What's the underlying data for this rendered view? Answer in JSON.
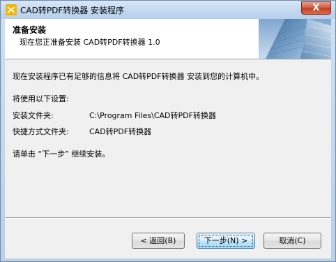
{
  "window": {
    "title": "CAD转PDF转换器 安装程序",
    "close_label": "X"
  },
  "header": {
    "title": "准备安装",
    "subtitle": "现在您正准备安装 CAD转PDF转换器 1.0"
  },
  "content": {
    "intro": "现在安装程序已有足够的信息将 CAD转PDF转换器 安装到您的计算机中。",
    "settings_heading": "将使用以下设置:",
    "install_folder_label": "安装文件夹:",
    "install_folder_value": "C:\\Program Files\\CAD转PDF转换器",
    "shortcut_folder_label": "快捷方式文件夹:",
    "shortcut_folder_value": "CAD转PDF转换器",
    "continue_text": "请单击 “下一步” 继续安装。"
  },
  "buttons": {
    "back": "< 返回(B)",
    "next": "下一步(N) >",
    "cancel": "取消(C)"
  },
  "colors": {
    "window_frame": "#b9d0ea",
    "client_bg": "#f0f0f0",
    "header_bg": "#ffffff",
    "close_button": "#c8462c",
    "default_button": "#bee6fd"
  },
  "icons": {
    "app": "app-installer-icon",
    "header_image": "skyscraper-image"
  }
}
